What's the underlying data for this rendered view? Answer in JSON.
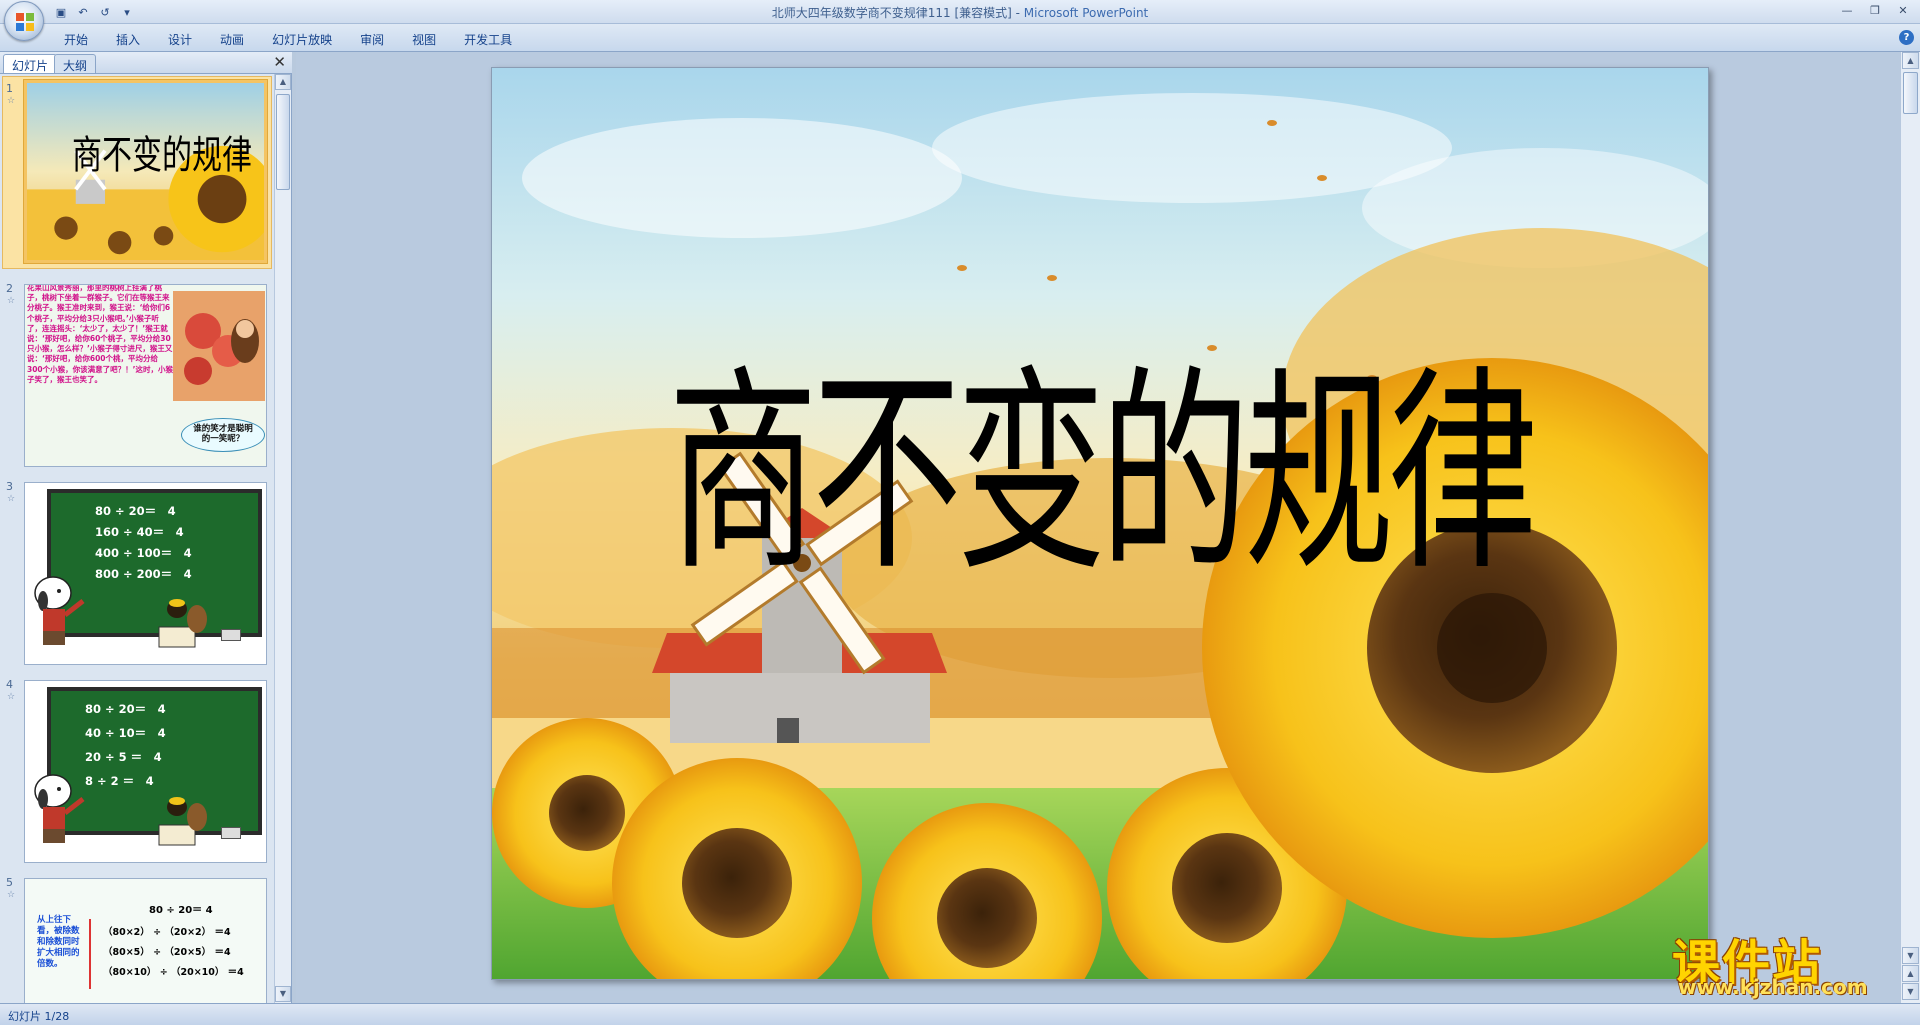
{
  "window": {
    "title_doc": "北师大四年级数学商不变规律111 [兼容模式] - ",
    "title_app": "Microsoft PowerPoint",
    "controls": {
      "minimize": "—",
      "restore": "❐",
      "close": "✕"
    }
  },
  "qat": {
    "save": "▣",
    "undo": "↶",
    "redo": "↺",
    "more": "▾"
  },
  "ribbon": {
    "tabs": [
      "开始",
      "插入",
      "设计",
      "动画",
      "幻灯片放映",
      "审阅",
      "视图",
      "开发工具"
    ],
    "help": "?"
  },
  "pane": {
    "tab_slides": "幻灯片",
    "tab_outline": "大纲",
    "close": "✕"
  },
  "thumbnails": [
    {
      "num": "1",
      "title": "商不变的规律"
    },
    {
      "num": "2",
      "text": "花果山风景秀丽，那里的桃树上挂满了桃子，桃树下坐着一群猴子。它们在等猴王来分桃子。猴王准时来到，猴王说：‘给你们6个桃子，平均分给3只小猴吧。’小猴子听了，连连摇头：‘太少了，太少了！’猴王就说：‘那好吧，给你60个桃子，平均分给30只小猴，怎么样？’小猴子得寸进尺，猴王又说：‘那好吧，给你600个桃，平均分给300个小猴，你该满意了吧？！’这时，小猴子笑了，猴王也笑了。",
      "bubble": "谁的笑才是聪明的一笑呢？"
    },
    {
      "num": "3",
      "lines": [
        "80 ÷ 20＝　4",
        "160 ÷ 40＝　4",
        "400 ÷ 100＝　4",
        "800 ÷ 200＝　4"
      ]
    },
    {
      "num": "4",
      "lines": [
        "80 ÷ 20＝　4",
        "40 ÷ 10＝　4",
        "20 ÷ 5 ＝　4",
        "8 ÷ 2 ＝　4"
      ]
    },
    {
      "num": "5",
      "head": "80 ÷ 20＝ 4",
      "side": "从上往下看，被除数和除数同时扩大相同的倍数。",
      "lines": [
        "（80×2） ÷ （20×2） ＝4",
        "（80×5） ÷ （20×5） ＝4",
        "（80×10） ÷ （20×10） ＝4"
      ]
    }
  ],
  "slide": {
    "title": "商不变的规律"
  },
  "watermark": {
    "brand": "课件站",
    "url": "www.kjzhan.com"
  },
  "status": {
    "text": "幻灯片 1/28"
  },
  "colors": {
    "ribbon": "#c7d8ed",
    "workspace": "#b9cadf",
    "selected_thumb": "#f4c463",
    "board_green": "#1d6a2c",
    "slide2_text": "#d1128a"
  }
}
